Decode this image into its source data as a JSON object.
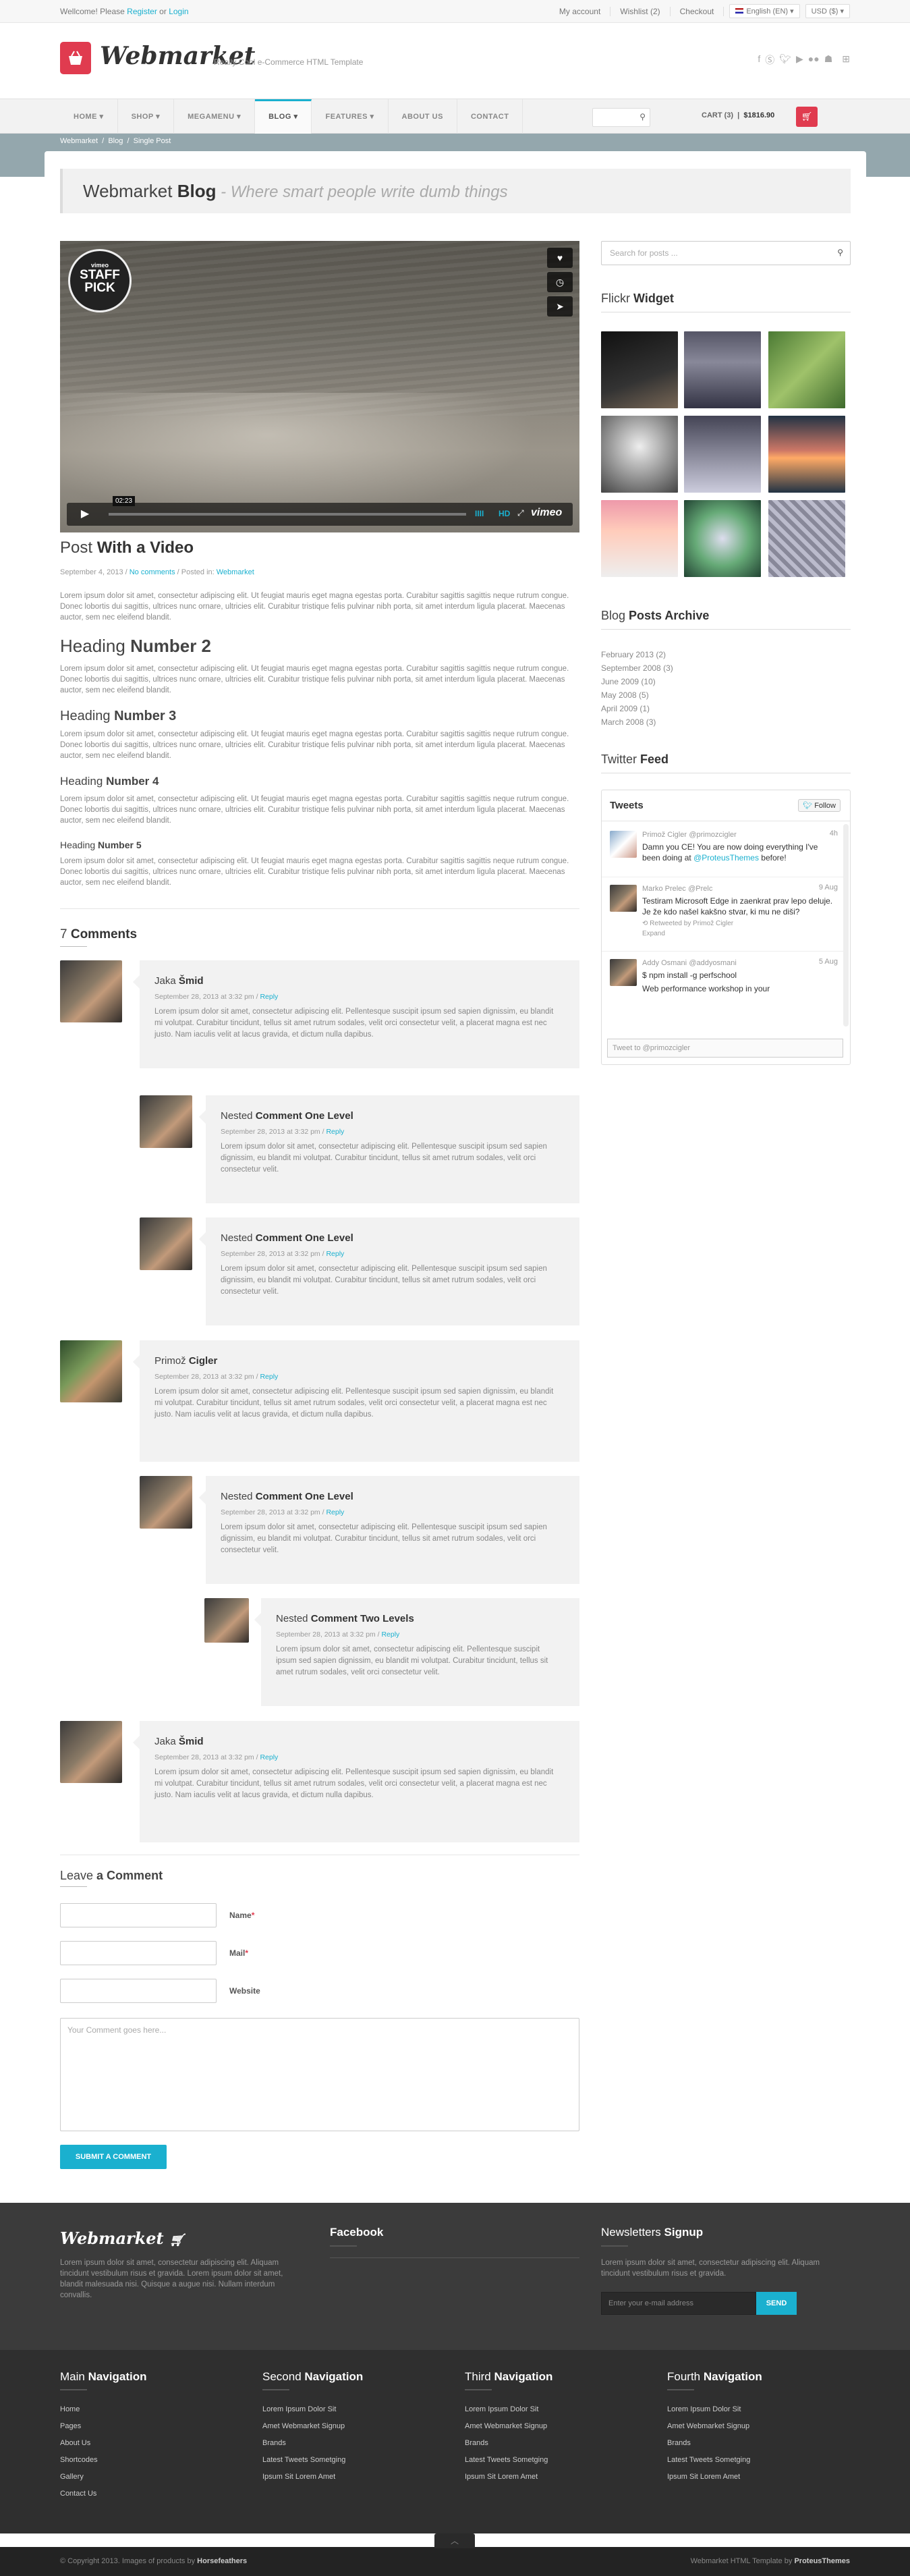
{
  "topbar": {
    "welcome_pre": "Wellcome! Please ",
    "register": "Register",
    "or": " or ",
    "login": "Login",
    "links": [
      "My account",
      "Wishlist (2)",
      "Checkout"
    ],
    "language": "English (EN)",
    "currency": "USD ($)"
  },
  "header": {
    "logo": "Webmarket",
    "tagline": "Really Cool e-Commerce HTML Template",
    "social_icons": [
      "facebook-icon",
      "skype-icon",
      "twitter-icon",
      "youtube-icon",
      "flickr-icon",
      "android-icon",
      "apple-icon",
      "windows-icon"
    ]
  },
  "nav": {
    "items": [
      "HOME",
      "SHOP",
      "MEGAMENU",
      "BLOG",
      "FEATURES",
      "ABOUT US",
      "CONTACT"
    ],
    "active": "BLOG",
    "cart_label": "CART (3)",
    "cart_total": "$1816.90"
  },
  "breadcrumbs": [
    "Webmarket",
    "Blog",
    "Single Post"
  ],
  "page_title": {
    "main": "Webmarket ",
    "bold": "Blog",
    "sub": " - Where smart people write dumb things"
  },
  "video": {
    "badge_top": "vimeo",
    "badge_main": "STAFF",
    "badge_sub": "PICK",
    "time": "02:23",
    "quality": "HD",
    "brand": "vimeo"
  },
  "post": {
    "title_pre": "Post ",
    "title_bold": "With a Video",
    "date": "September 4, 2013 / ",
    "comments_link": "No comments",
    "posted_in": " / Posted in: ",
    "category": "Webmarket",
    "lorem": "Lorem ipsum dolor sit amet, consectetur adipiscing elit. Ut feugiat mauris eget magna egestas porta. Curabitur sagittis sagittis neque rutrum congue. Donec lobortis dui sagittis, ultrices nunc ornare, ultricies elit. Curabitur tristique felis pulvinar nibh porta, sit amet interdum ligula placerat. Maecenas auctor, sem nec eleifend blandit.",
    "h2_pre": "Heading ",
    "h2_bold": "Number 2",
    "h3_pre": "Heading ",
    "h3_bold": "Number 3",
    "h4_pre": "Heading ",
    "h4_bold": "Number 4",
    "h5_pre": "Heading ",
    "h5_bold": "Number 5"
  },
  "comments": {
    "count_label": "7 ",
    "title_bold": "Comments",
    "reply": "Reply",
    "lorem": "Lorem ipsum dolor sit amet, consectetur adipiscing elit. Pellentesque suscipit ipsum sed sapien dignissim, eu blandit mi volutpat. Curabitur tincidunt, tellus sit amet rutrum sodales, velit orci consectetur velit, a placerat magna est nec justo. Nam iaculis velit at lacus gravida, et dictum nulla dapibus.",
    "lorem_short": "Lorem ipsum dolor sit amet, consectetur adipiscing elit. Pellentesque suscipit ipsum sed sapien dignissim, eu blandit mi volutpat. Curabitur tincidunt, tellus sit amet rutrum sodales, velit orci consectetur velit.",
    "date": "September 28, 2013 at 3:32 pm / ",
    "items": [
      {
        "name_pre": "Jaka ",
        "name_bold": "Šmid"
      },
      {
        "name_pre": "Nested ",
        "name_bold": "Comment One Level"
      },
      {
        "name_pre": "Nested ",
        "name_bold": "Comment One Level"
      },
      {
        "name_pre": "Primož ",
        "name_bold": "Cigler"
      },
      {
        "name_pre": "Nested ",
        "name_bold": "Comment One Level"
      },
      {
        "name_pre": "Nested ",
        "name_bold": "Comment Two Levels"
      },
      {
        "name_pre": "Jaka ",
        "name_bold": "Šmid"
      }
    ]
  },
  "form": {
    "title_pre": "Leave ",
    "title_bold": "a Comment",
    "name_label": "Name",
    "mail_label": "Mail",
    "website_label": "Website",
    "req": "*",
    "textarea_placeholder": "Your Comment goes here...",
    "submit": "SUBMIT A COMMENT"
  },
  "sidebar": {
    "search_placeholder": "Search for posts ...",
    "flickr_pre": "Flickr ",
    "flickr_bold": "Widget",
    "archive_pre": "Blog ",
    "archive_bold": "Posts Archive",
    "archive": [
      {
        "m": "February 2013",
        "c": " (2)"
      },
      {
        "m": "September 2008",
        "c": " (3)"
      },
      {
        "m": "June 2009",
        "c": " (10)"
      },
      {
        "m": "May 2008",
        "c": " (5)"
      },
      {
        "m": "April 2009",
        "c": " (1)"
      },
      {
        "m": "March 2008",
        "c": " (3)"
      }
    ],
    "twitter_pre": "Twitter ",
    "twitter_bold": "Feed"
  },
  "twitter": {
    "title": "Tweets",
    "follow": "Follow",
    "tweet_to": "Tweet to @primozcigler",
    "tweets": [
      {
        "name": "Primož Cigler",
        "handle": "@primozcigler",
        "time": "4h",
        "body_pre": "Damn you CE! You are now doing everything I've been doing at ",
        "body_link": "@ProteusThemes",
        "body_post": " before!",
        "extra": ""
      },
      {
        "name": "Marko Prelec",
        "handle": "@Prelc",
        "time": "9 Aug",
        "body_pre": "Testiram Microsoft Edge in zaenkrat prav lepo deluje. Je že kdo našel kakšno stvar, ki mu ne diši?",
        "body_link": "",
        "body_post": "",
        "extra": "Retweeted by Primož Cigler",
        "expand": "Expand"
      },
      {
        "name": "Addy Osmani",
        "handle": "@addyosmani",
        "time": "5 Aug",
        "body_pre": "$ npm install -g perfschool",
        "body_link": "",
        "body_post": "",
        "extra": "Web performance workshop in your"
      }
    ]
  },
  "footer": {
    "logo": "Webmarket",
    "about": "Lorem ipsum dolor sit amet, consectetur adipiscing elit. Aliquam tincidunt vestibulum risus et gravida. Lorem ipsum dolor sit amet, blandit malesuada nisi. Quisque a augue nisi. Nullam interdum convallis.",
    "facebook": "Facebook",
    "news_pre": "Newsletters ",
    "news_bold": "Signup",
    "news_text": "Lorem ipsum dolor sit amet, consectetur adipiscing elit. Aliquam tincidunt vestibulum risus et gravida.",
    "email_placeholder": "Enter your e-mail address",
    "send": "SEND",
    "navs": [
      {
        "pre": "Main ",
        "bold": "Navigation",
        "links": [
          "Home",
          "Pages",
          "About Us",
          "Shortcodes",
          "Gallery",
          "Contact Us"
        ]
      },
      {
        "pre": "Second ",
        "bold": "Navigation",
        "links": [
          "Lorem Ipsum Dolor Sit",
          "Amet Webmarket Signup",
          "Brands",
          "Latest Tweets Sometging",
          "Ipsum Sit Lorem Amet"
        ]
      },
      {
        "pre": "Third ",
        "bold": "Navigation",
        "links": [
          "Lorem Ipsum Dolor Sit",
          "Amet Webmarket Signup",
          "Brands",
          "Latest Tweets Sometging",
          "Ipsum Sit Lorem Amet"
        ]
      },
      {
        "pre": "Fourth ",
        "bold": "Navigation",
        "links": [
          "Lorem Ipsum Dolor Sit",
          "Amet Webmarket Signup",
          "Brands",
          "Latest Tweets Sometging",
          "Ipsum Sit Lorem Amet"
        ]
      }
    ],
    "copyright_pre": "© Copyright 2013. Images of products by ",
    "copyright_bold": "Horsefeathers",
    "credit_pre": "Webmarket HTML Template by ",
    "credit_bold": "ProteusThemes"
  },
  "colors": {
    "accent": "#1ab0cf",
    "brand_red": "#e03b4f"
  }
}
